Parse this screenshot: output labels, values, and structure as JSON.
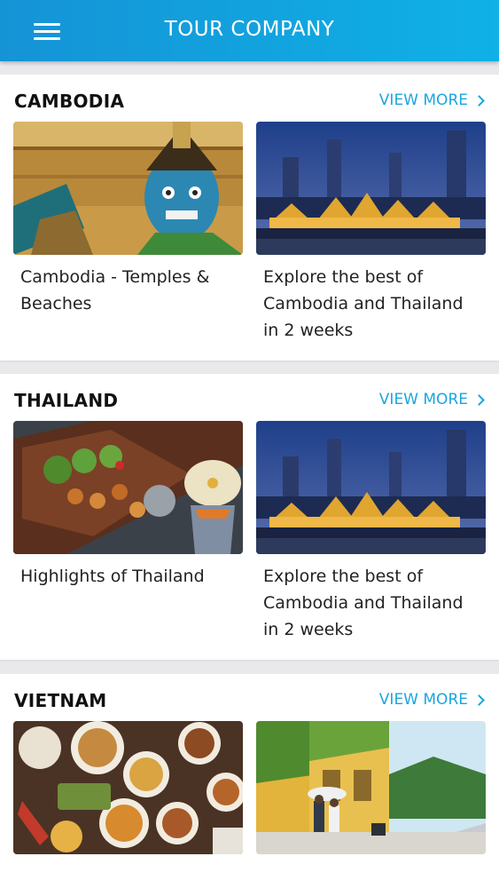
{
  "app": {
    "title": "TOUR COMPANY"
  },
  "sections": [
    {
      "title": "CAMBODIA",
      "view_more": "VIEW MORE",
      "cards": [
        {
          "title": "Cambodia - Temples & Beaches",
          "image": "temple-guardian-statue"
        },
        {
          "title": "Explore the best of Cambodia and Thailand in 2 weeks",
          "image": "bangkok-palace-night"
        }
      ]
    },
    {
      "title": "THAILAND",
      "view_more": "VIEW MORE",
      "cards": [
        {
          "title": "Highlights of Thailand",
          "image": "floating-market-boat"
        },
        {
          "title": "Explore the best of Cambodia and Thailand in 2 weeks",
          "image": "bangkok-palace-night"
        }
      ]
    },
    {
      "title": "VIETNAM",
      "view_more": "VIEW MORE",
      "cards": [
        {
          "title": "",
          "image": "vietnamese-food-spread"
        },
        {
          "title": "",
          "image": "hoi-an-street"
        }
      ]
    }
  ],
  "colors": {
    "header_start": "#1593d6",
    "header_end": "#0fb1e6",
    "accent": "#1aa6df"
  }
}
